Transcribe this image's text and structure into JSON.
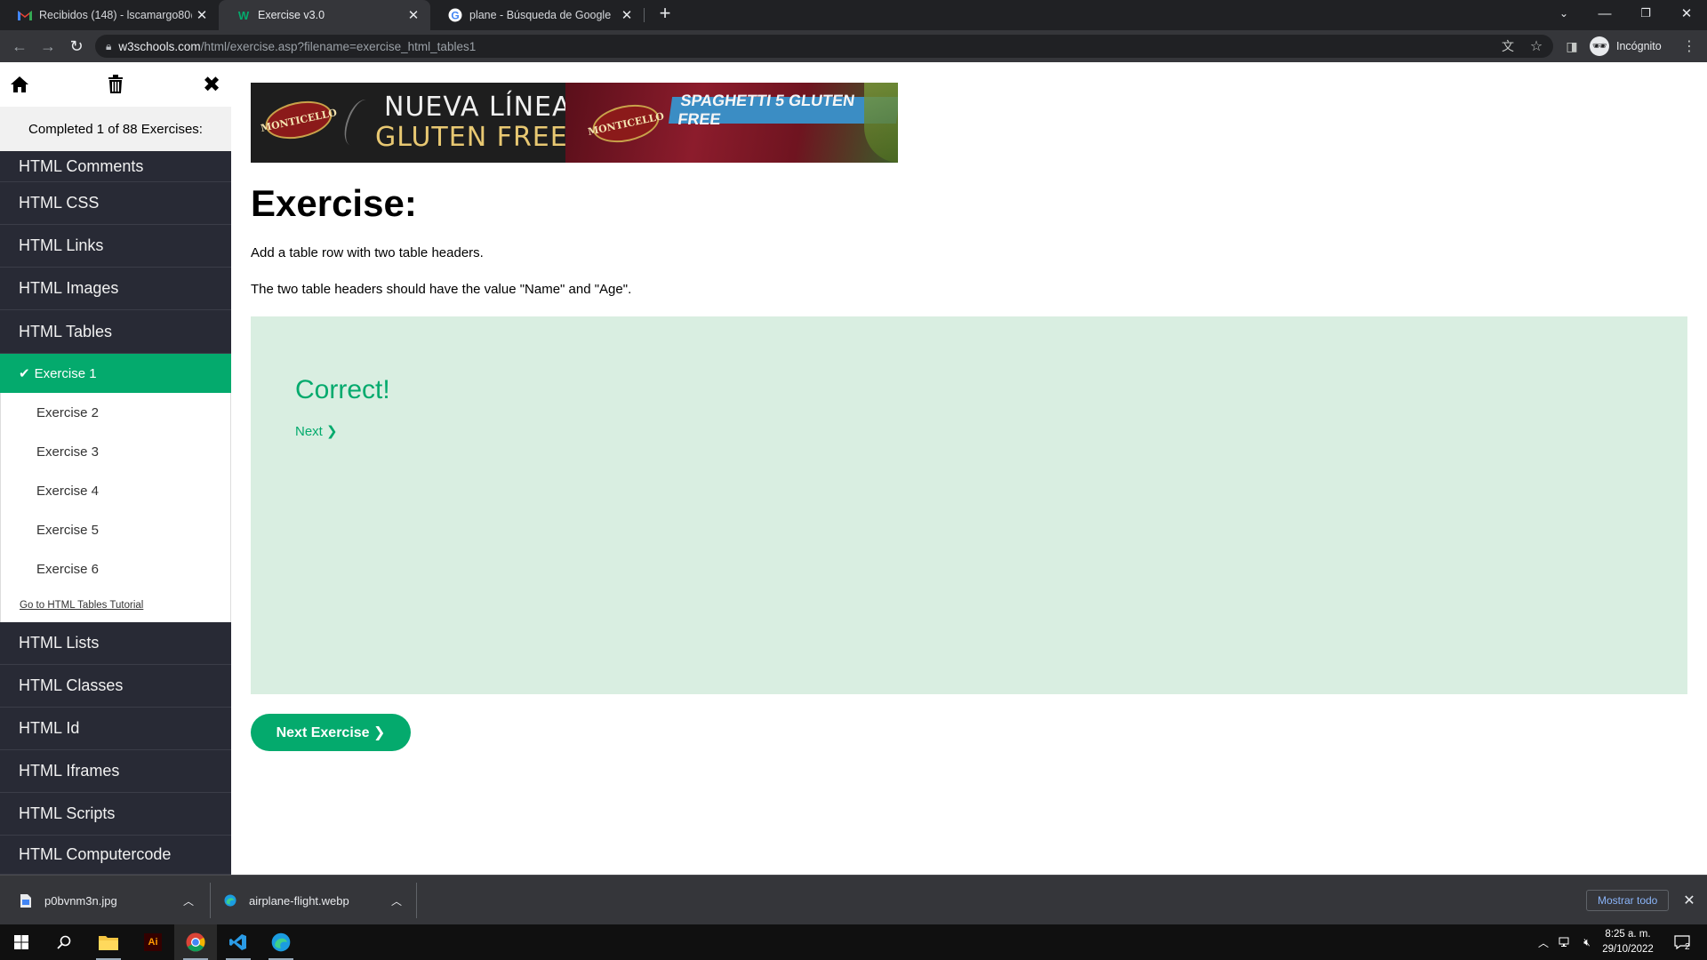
{
  "browser": {
    "tabs": [
      {
        "title": "Recibidos (148) - lscamargo80@",
        "favicon": "gmail-icon",
        "active": false
      },
      {
        "title": "Exercise v3.0",
        "favicon": "w3schools-icon",
        "active": true
      },
      {
        "title": "plane - Búsqueda de Google",
        "favicon": "google-icon",
        "active": false
      }
    ],
    "url_host": "w3schools.com",
    "url_path": "/html/exercise.asp?filename=exercise_html_tables1",
    "profile_label": "Incógnito"
  },
  "sidebar": {
    "progress_text": "Completed 1 of 88 Exercises:",
    "chapters_before": [
      {
        "label": "HTML Comments"
      },
      {
        "label": "HTML CSS"
      },
      {
        "label": "HTML Links"
      },
      {
        "label": "HTML Images"
      },
      {
        "label": "HTML Tables"
      }
    ],
    "exercises": [
      {
        "label": "Exercise 1",
        "completed": true,
        "active": true
      },
      {
        "label": "Exercise 2",
        "completed": false,
        "active": false
      },
      {
        "label": "Exercise 3",
        "completed": false,
        "active": false
      },
      {
        "label": "Exercise 4",
        "completed": false,
        "active": false
      },
      {
        "label": "Exercise 5",
        "completed": false,
        "active": false
      },
      {
        "label": "Exercise 6",
        "completed": false,
        "active": false
      }
    ],
    "tutorial_link": "Go to HTML Tables Tutorial",
    "chapters_after": [
      {
        "label": "HTML Lists"
      },
      {
        "label": "HTML Classes"
      },
      {
        "label": "HTML Id"
      },
      {
        "label": "HTML Iframes"
      },
      {
        "label": "HTML Scripts"
      },
      {
        "label": "HTML Computercode"
      }
    ]
  },
  "ad": {
    "brand": "MONTICELLO",
    "line1": "NUEVA LÍNEA",
    "line2": "GLUTEN FREE",
    "pack_text": "SPAGHETTI 5 GLUTEN FREE"
  },
  "exercise": {
    "title": "Exercise:",
    "instruction_1": "Add a table row with two table headers.",
    "instruction_2": "The two table headers should have the value \"Name\" and \"Age\".",
    "result_text": "Correct!",
    "next_link": "Next ❯",
    "next_button": "Next Exercise ❯"
  },
  "downloads": {
    "items": [
      {
        "filename": "p0bvnm3n.jpg",
        "icon": "file-icon"
      },
      {
        "filename": "airplane-flight.webp",
        "icon": "edge-icon"
      }
    ],
    "show_all": "Mostrar todo"
  },
  "taskbar": {
    "time": "8:25 a. m.",
    "date": "29/10/2022",
    "notification_count": "2"
  },
  "colors": {
    "accent": "#04aa6d",
    "sidebar_dark": "#282a35",
    "result_bg": "#d9eee1"
  }
}
